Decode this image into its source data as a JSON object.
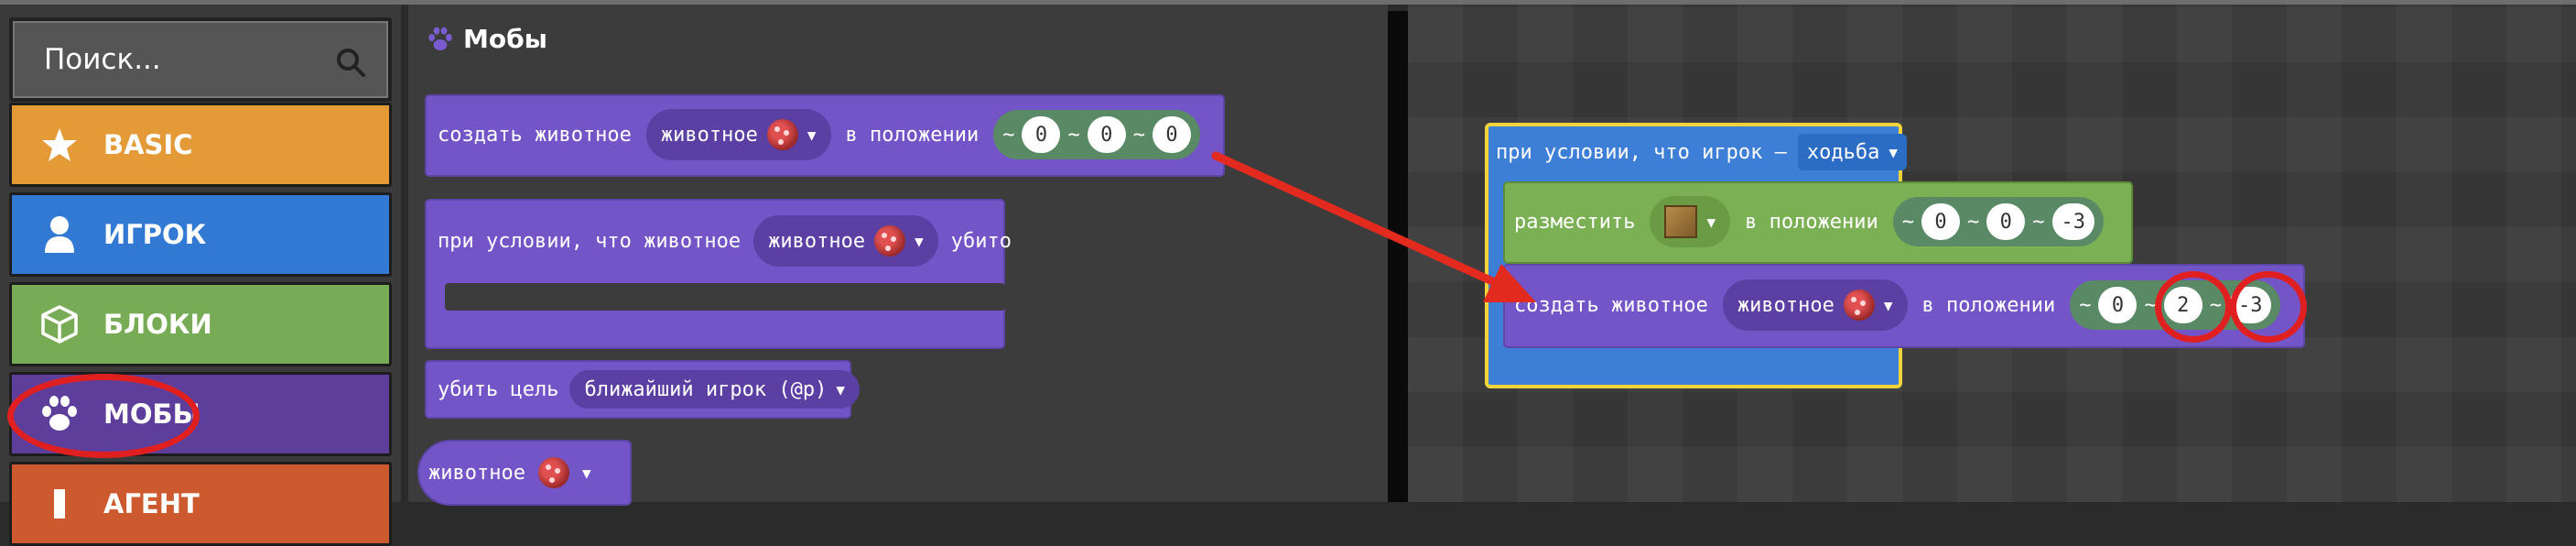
{
  "search": {
    "placeholder": "Поиск..."
  },
  "categories": [
    {
      "label": "BASIC",
      "icon": "star-icon"
    },
    {
      "label": "ИГРОК",
      "icon": "person-icon"
    },
    {
      "label": "БЛОКИ",
      "icon": "cube-icon"
    },
    {
      "label": "МОБЫ",
      "icon": "paw-icon"
    },
    {
      "label": "АГЕНТ",
      "icon": "agent-icon"
    }
  ],
  "flyout": {
    "title": "Мобы",
    "spawn": {
      "prefix": "создать животное",
      "dropdown": "животное",
      "mid": "в положении",
      "x": "0",
      "y": "0",
      "z": "0"
    },
    "on_killed": {
      "prefix": "при условии, что животное",
      "dropdown": "животное",
      "suffix": "убито"
    },
    "kill": {
      "prefix": "убить цель",
      "dropdown": "ближайший игрок (@p)"
    },
    "animal": {
      "dropdown": "животное"
    }
  },
  "workspace": {
    "event": {
      "prefix": "при условии, что игрок —",
      "dropdown": "ходьба"
    },
    "place": {
      "prefix": "разместить",
      "mid": "в положении",
      "x": "0",
      "y": "0",
      "z": "-3"
    },
    "spawn": {
      "prefix": "создать животное",
      "dropdown": "животное",
      "mid": "в положении",
      "x": "0",
      "y": "2",
      "z": "-3"
    }
  },
  "tilde": "~",
  "colors": {
    "basic": "#e39a37",
    "player": "#3279d3",
    "blocks": "#78ab55",
    "mobs": "#5d3e9a",
    "agent": "#cc5a2e",
    "highlight": "#e02020",
    "event_border": "#f2d43a"
  }
}
